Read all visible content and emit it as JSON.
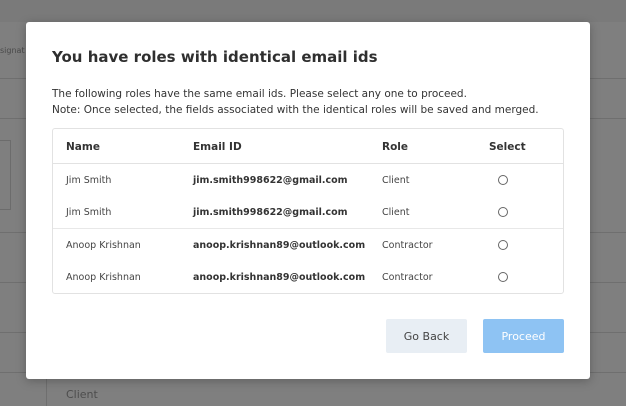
{
  "background": {
    "side_label": "signat",
    "client_label": "Client"
  },
  "modal": {
    "title": "You have roles with identical email ids",
    "desc_line1": "The following roles have the same email ids. Please select any one to proceed.",
    "desc_line2": "Note: Once selected, the fields associated with the identical roles will be saved and merged.",
    "table": {
      "headers": {
        "name": "Name",
        "email": "Email ID",
        "role": "Role",
        "select": "Select"
      },
      "rows": [
        {
          "name": "Jim Smith",
          "email": "jim.smith998622@gmail.com",
          "role": "Client"
        },
        {
          "name": "Jim Smith",
          "email": "jim.smith998622@gmail.com",
          "role": "Client"
        },
        {
          "name": "Anoop Krishnan",
          "email": "anoop.krishnan89@outlook.com",
          "role": "Contractor"
        },
        {
          "name": "Anoop Krishnan",
          "email": "anoop.krishnan89@outlook.com",
          "role": "Contractor"
        }
      ]
    },
    "buttons": {
      "back": "Go Back",
      "proceed": "Proceed"
    }
  },
  "colors": {
    "overlay": "#7b7b7b",
    "proceed_button": "#8ec3f3",
    "back_button": "#e8eef4"
  }
}
